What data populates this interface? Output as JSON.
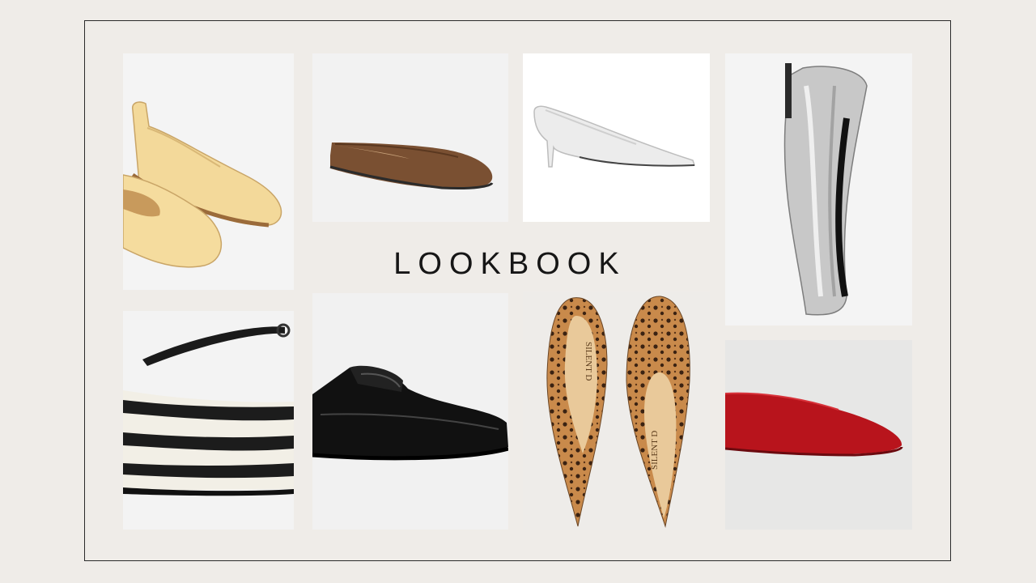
{
  "title": "LOOKBOOK",
  "tiles": [
    {
      "name": "yellow-leather-ballet-flats",
      "brand_text": ""
    },
    {
      "name": "brown-suede-mule",
      "brand_text": ""
    },
    {
      "name": "white-kitten-heel-pump",
      "brand_text": ""
    },
    {
      "name": "silver-metallic-flat",
      "brand_text": ""
    },
    {
      "name": "zebra-print-strap-flat",
      "brand_text": ""
    },
    {
      "name": "black-patent-loafer",
      "brand_text": ""
    },
    {
      "name": "leopard-pointed-flats",
      "brand_text": "SILENT D"
    },
    {
      "name": "red-suede-flat",
      "brand_text": ""
    }
  ]
}
